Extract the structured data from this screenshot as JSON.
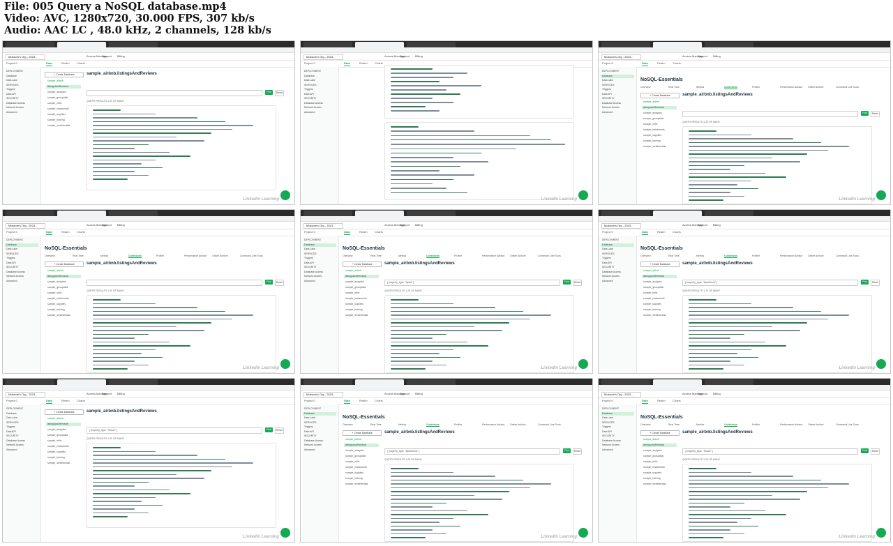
{
  "header": {
    "file": "File: 005 Query a NoSQL database.mp4",
    "video": "Video: AVC, 1280x720, 30.000 FPS, 307 kb/s",
    "audio": "Audio: AAC LC , 48.0 kHz, 2 channels, 128 kb/s"
  },
  "atlas": {
    "org_label": "Mossom's Org - 2023...",
    "project_label": "Project 0",
    "nav_items": [
      "Access Manager",
      "Support",
      "Billing"
    ],
    "subnav_tabs": [
      "Data",
      "Realm",
      "Charts"
    ],
    "sidebar_items": [
      "DEPLOYMENT",
      "Database",
      "Data Lake",
      "SERVICES",
      "Triggers",
      "Data API",
      "SECURITY",
      "Database Access",
      "Network Access",
      "Advanced"
    ],
    "cluster_title": "NoSQL-Essentials",
    "collection_tabs": [
      "Overview",
      "Real Time",
      "Metrics",
      "Collections",
      "Profiler",
      "Performance Advisor",
      "Online Archive",
      "Command Line Tools"
    ],
    "create_db": "+ Create Database",
    "databases": [
      "sample_airbnb",
      "listingsAndReviews",
      "sample_analytics",
      "sample_geospatial",
      "sample_mflix",
      "sample_restaurants",
      "sample_supplies",
      "sample_training",
      "sample_weatherdata"
    ],
    "collection_title": "sample_airbnb.listingsAndReviews",
    "find": "Find",
    "reset": "Reset",
    "results": "QUERY RESULTS 1-20 OF MANY",
    "watermark": "LinkedIn Learning",
    "filters": [
      "",
      "",
      "",
      "",
      "{ property_type: \"Apart\" }",
      "{ property_type: \"Apartment\" }",
      "{ property_type: \"House\" }",
      "{ property_type: \"Apartment\" }",
      "{ property_type: \"House\" }"
    ]
  }
}
